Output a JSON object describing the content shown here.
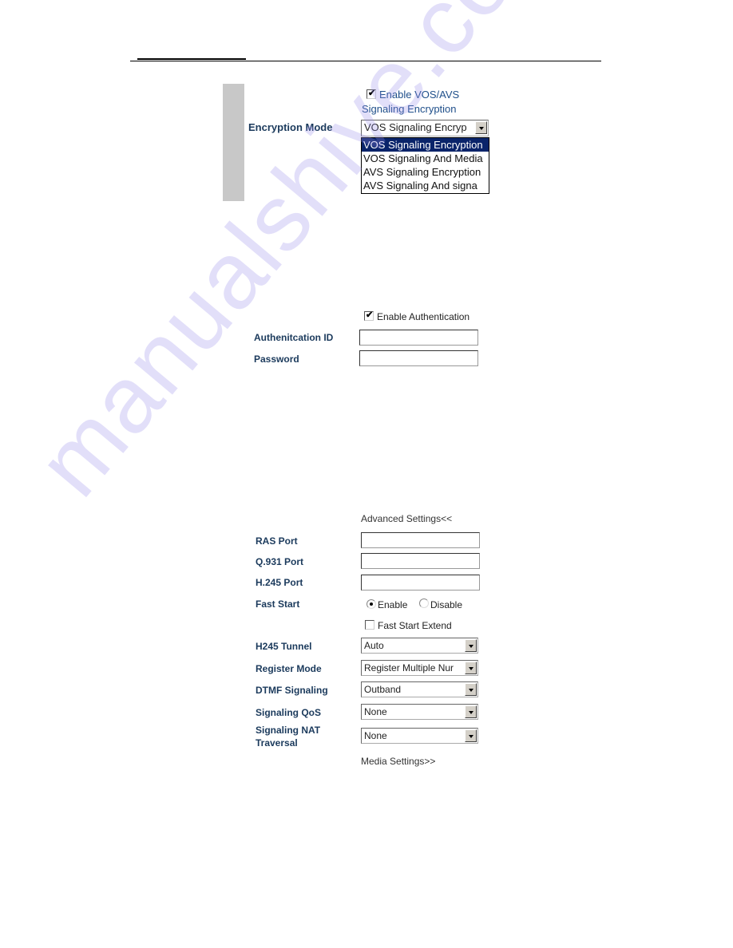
{
  "encryption": {
    "enable_checkbox": {
      "label_line1": "Enable VOS/AVS",
      "label_line2": "Signaling Encryption",
      "checked": true
    },
    "mode_label": "Encryption Mode",
    "mode_select": {
      "value": "VOS Signaling Encryp",
      "options": [
        "VOS Signaling Encryption",
        "VOS Signaling And Media",
        "AVS Signaling Encryption",
        "AVS Signaling And signa"
      ],
      "highlighted_index": 0
    }
  },
  "authentication": {
    "enable_checkbox": {
      "label": "Enable Authentication",
      "checked": true
    },
    "id_label": "Authenitcation ID",
    "id_value": "",
    "password_label": "Password",
    "password_value": ""
  },
  "advanced": {
    "toggle_link": "Advanced Settings<<",
    "ras_port_label": "RAS Port",
    "ras_port_value": "",
    "q931_port_label": "Q.931 Port",
    "q931_port_value": "",
    "h245_port_label": "H.245 Port",
    "h245_port_value": "",
    "fast_start_label": "Fast Start",
    "fast_start_enable": "Enable",
    "fast_start_disable": "Disable",
    "fast_start_selected": "Enable",
    "fast_start_extend": {
      "label": "Fast Start Extend",
      "checked": false
    },
    "h245_tunnel_label": "H245 Tunnel",
    "h245_tunnel_value": "Auto",
    "register_mode_label": "Register Mode",
    "register_mode_value": "Register Multiple Nur",
    "dtmf_label": "DTMF Signaling",
    "dtmf_value": "Outband",
    "qos_label": "Signaling QoS",
    "qos_value": "None",
    "nat_label_line1": "Signaling NAT",
    "nat_label_line2": "Traversal",
    "nat_value": "None",
    "media_link": "Media Settings>>"
  },
  "watermark": "manualshive.com"
}
